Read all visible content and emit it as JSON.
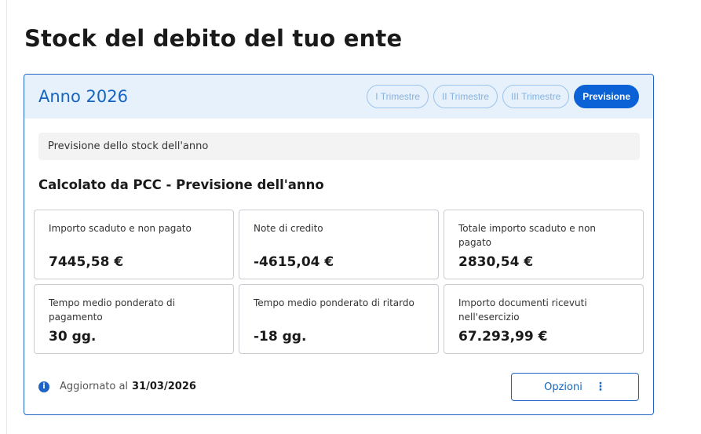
{
  "page": {
    "title": "Stock del debito del tuo ente"
  },
  "card": {
    "year_title": "Anno 2026",
    "tabs": [
      {
        "label": "I Trimestre",
        "active": false
      },
      {
        "label": "II Trimestre",
        "active": false
      },
      {
        "label": "III Trimestre",
        "active": false
      },
      {
        "label": "Previsione",
        "active": true
      }
    ],
    "notice": "Previsione dello stock dell'anno",
    "section_title": "Calcolato da PCC - Previsione dell'anno",
    "metrics": [
      {
        "label": "Importo scaduto e non pagato",
        "value": "7445,58 €"
      },
      {
        "label": "Note di credito",
        "value": "-4615,04 €"
      },
      {
        "label": "Totale importo scaduto e non pagato",
        "value": "2830,54 €"
      },
      {
        "label": "Tempo medio ponderato di pagamento",
        "value": "30 gg."
      },
      {
        "label": "Tempo medio ponderato di ritardo",
        "value": "-18 gg."
      },
      {
        "label": "Importo documenti ricevuti nell'esercizio",
        "value": "67.293,99 €"
      }
    ],
    "footer": {
      "updated_label": "Aggiornato al",
      "updated_date": "31/03/2026",
      "info_icon": "i",
      "options_label": "Opzioni",
      "options_icon": "⋮"
    }
  },
  "colors": {
    "accent": "#1f63c6",
    "header_bg": "#e6f1fc",
    "active_tab": "#0a62d6"
  }
}
